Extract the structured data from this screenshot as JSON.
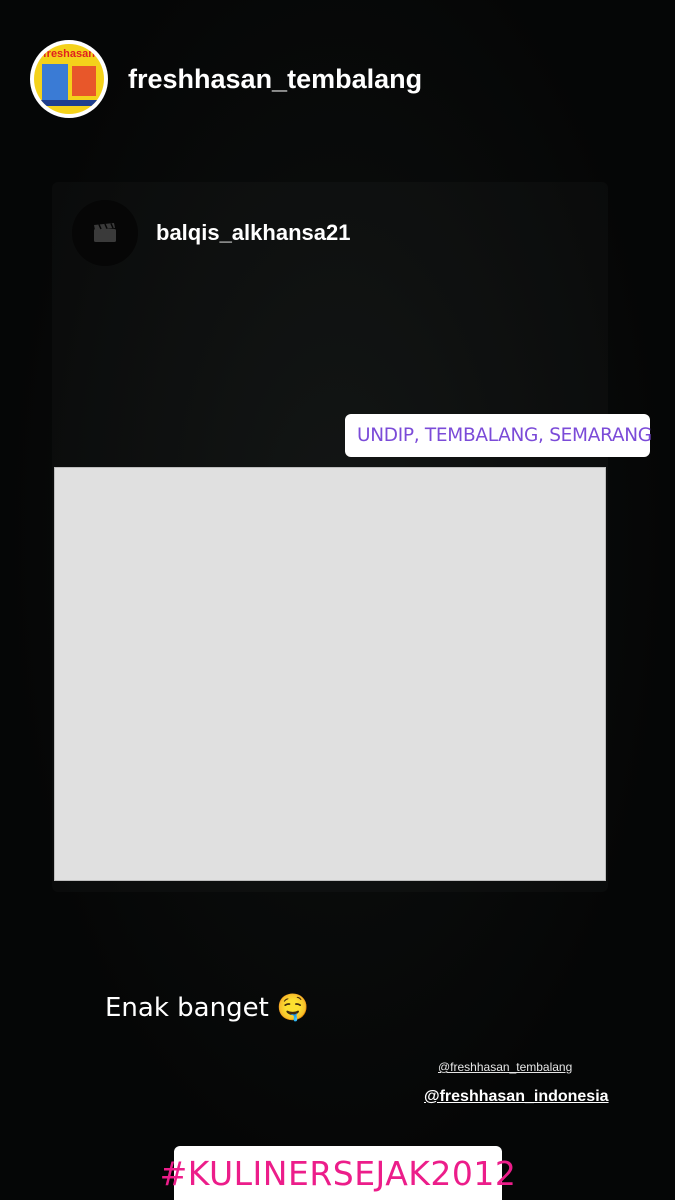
{
  "story": {
    "author": {
      "username": "freshhasan_tembalang",
      "avatar_brand_text": "freshasan"
    },
    "shared_post": {
      "username": "balqis_alkhansa21",
      "icon": "clapperboard-icon"
    },
    "location_sticker": {
      "icon": "location-pin-icon",
      "text": "UNDIP, TEMBALANG, SEMARANG",
      "color": "#7b4bd8"
    },
    "caption": {
      "text": "Enak banget",
      "emoji": "🤤"
    },
    "mentions": [
      "@freshhasan_tembalang",
      "@freshhasan_indonesia"
    ],
    "hashtag": {
      "text": "#KULINERSEJAK2012",
      "color": "#ec1d8a"
    }
  }
}
